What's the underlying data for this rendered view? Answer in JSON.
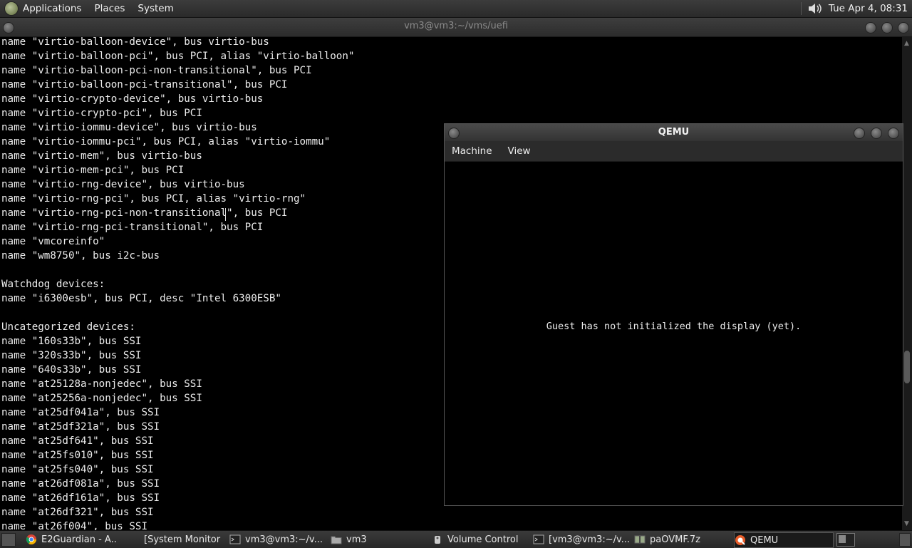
{
  "top_panel": {
    "menus": [
      "Applications",
      "Places",
      "System"
    ],
    "clock": "Tue Apr  4, 08:31"
  },
  "terminal": {
    "title": "vm3@vm3:~/vms/uefi",
    "lines": [
      "name \"virtio-balloon-device\", bus virtio-bus",
      "name \"virtio-balloon-pci\", bus PCI, alias \"virtio-balloon\"",
      "name \"virtio-balloon-pci-non-transitional\", bus PCI",
      "name \"virtio-balloon-pci-transitional\", bus PCI",
      "name \"virtio-crypto-device\", bus virtio-bus",
      "name \"virtio-crypto-pci\", bus PCI",
      "name \"virtio-iommu-device\", bus virtio-bus",
      "name \"virtio-iommu-pci\", bus PCI, alias \"virtio-iommu\"",
      "name \"virtio-mem\", bus virtio-bus",
      "name \"virtio-mem-pci\", bus PCI",
      "name \"virtio-rng-device\", bus virtio-bus",
      "name \"virtio-rng-pci\", bus PCI, alias \"virtio-rng\"",
      "name \"virtio-rng-pci-non-transitional\", bus PCI",
      "name \"virtio-rng-pci-transitional\", bus PCI",
      "name \"vmcoreinfo\"",
      "name \"wm8750\", bus i2c-bus",
      "",
      "Watchdog devices:",
      "name \"i6300esb\", bus PCI, desc \"Intel 6300ESB\"",
      "",
      "Uncategorized devices:",
      "name \"160s33b\", bus SSI",
      "name \"320s33b\", bus SSI",
      "name \"640s33b\", bus SSI",
      "name \"at25128a-nonjedec\", bus SSI",
      "name \"at25256a-nonjedec\", bus SSI",
      "name \"at25df041a\", bus SSI",
      "name \"at25df321a\", bus SSI",
      "name \"at25df641\", bus SSI",
      "name \"at25fs010\", bus SSI",
      "name \"at25fs040\", bus SSI",
      "name \"at26df081a\", bus SSI",
      "name \"at26df161a\", bus SSI",
      "name \"at26df321\", bus SSI",
      "name \"at26f004\", bus SSI"
    ]
  },
  "qemu": {
    "title": "QEMU",
    "menus": [
      "Machine",
      "View"
    ],
    "display_message": "Guest has not initialized the display (yet)."
  },
  "taskbar": {
    "items": [
      {
        "label": "E2Guardian - A...",
        "icon": "chrome-icon"
      },
      {
        "label": "[System Monitor]",
        "icon": "system-monitor-icon"
      },
      {
        "label": "vm3@vm3:~/v...",
        "icon": "terminal-icon"
      },
      {
        "label": "vm3",
        "icon": "folder-icon"
      },
      {
        "label": "Volume Control",
        "icon": "volume-control-icon"
      },
      {
        "label": "[vm3@vm3:~/v...",
        "icon": "terminal-icon"
      },
      {
        "label": "paOVMF.7z",
        "icon": "archive-icon"
      },
      {
        "label": "QEMU",
        "icon": "qemu-icon"
      }
    ]
  }
}
